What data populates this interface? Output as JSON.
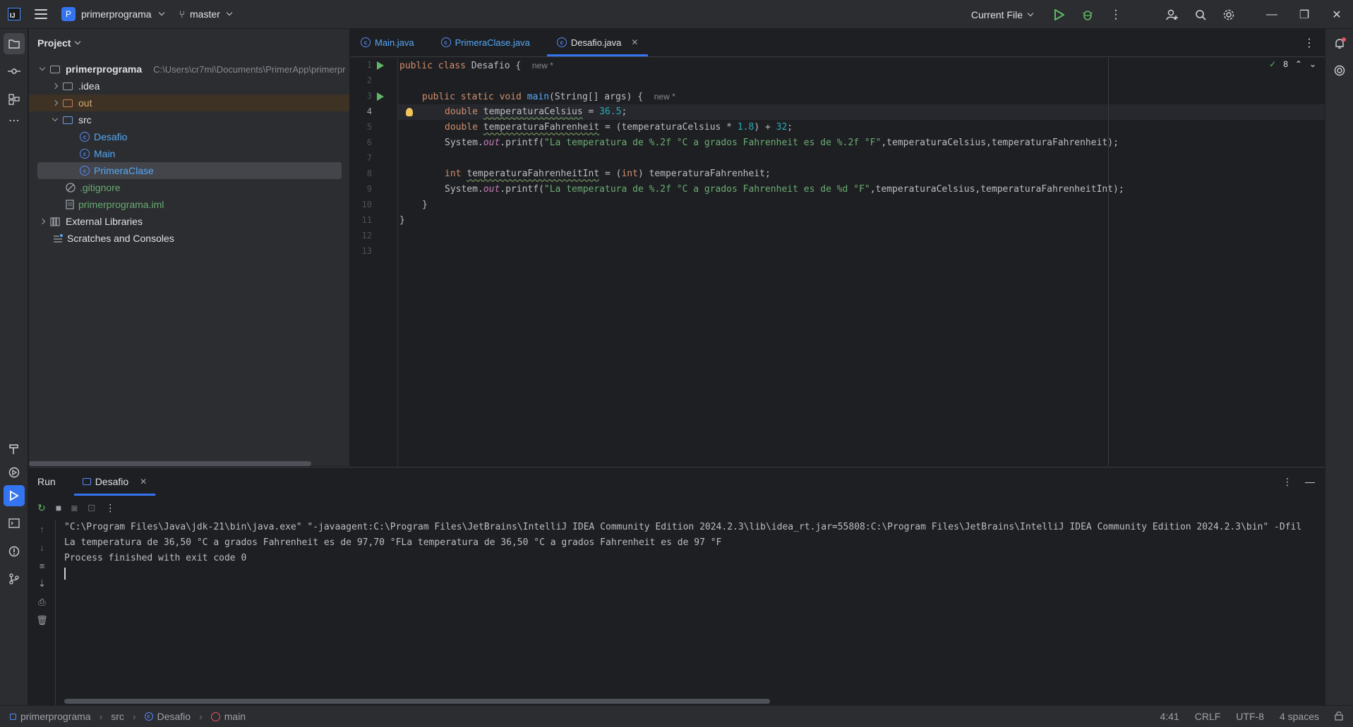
{
  "titlebar": {
    "project_letter": "P",
    "project_name": "primerprograma",
    "branch": "master",
    "run_config": "Current File"
  },
  "project_panel": {
    "title": "Project",
    "root_name": "primerprograma",
    "root_path": "C:\\Users\\cr7mi\\Documents\\PrimerApp\\primerpr",
    "items": [
      {
        "label": ".idea"
      },
      {
        "label": "out"
      },
      {
        "label": "src"
      },
      {
        "label": "Desafio"
      },
      {
        "label": "Main"
      },
      {
        "label": "PrimeraClase"
      },
      {
        "label": ".gitignore"
      },
      {
        "label": "primerprograma.iml"
      },
      {
        "label": "External Libraries"
      },
      {
        "label": "Scratches and Consoles"
      }
    ]
  },
  "editor": {
    "tabs": [
      {
        "label": "Main.java"
      },
      {
        "label": "PrimeraClase.java"
      },
      {
        "label": "Desafio.java"
      }
    ],
    "inspection_count": "8",
    "line_numbers": [
      "1",
      "2",
      "3",
      "4",
      "5",
      "6",
      "7",
      "8",
      "9",
      "10",
      "11",
      "12",
      "13"
    ],
    "hint_new": "new *",
    "code": {
      "l1_kw": "public class",
      "l1_name": "Desafio",
      "l1_brace": " {",
      "l3_kw": "public static void",
      "l3_fn": "main",
      "l3_rest": "(String[] args) {",
      "l4_kw": "double",
      "l4_var": "temperaturaCelsius",
      "l4_eq": " = ",
      "l4_num": "36.5",
      "l4_end": ";",
      "l5_kw": "double",
      "l5_var": "temperaturaFahrenheit",
      "l5_mid": " = (temperaturaCelsius * ",
      "l5_num1": "1.8",
      "l5_mid2": ") + ",
      "l5_num2": "32",
      "l5_end": ";",
      "l6_pre": "System.",
      "l6_out": "out",
      "l6_call": ".printf(",
      "l6_str": "\"La temperatura de %.2f °C a grados Fahrenheit es de %.2f °F\"",
      "l6_end": ",temperaturaCelsius,temperaturaFahrenheit);",
      "l8_kw": "int",
      "l8_var": "temperaturaFahrenheitInt",
      "l8_mid": " = (",
      "l8_kw2": "int",
      "l8_end": ") temperaturaFahrenheit;",
      "l9_pre": "System.",
      "l9_out": "out",
      "l9_call": ".printf(",
      "l9_str": "\"La temperatura de %.2f °C a grados Fahrenheit es de %d °F\"",
      "l9_end": ",temperaturaCelsius,temperaturaFahrenheitInt);",
      "l10": "}",
      "l11": "}"
    }
  },
  "run_panel": {
    "title": "Run",
    "tab_label": "Desafio",
    "console_lines": [
      "\"C:\\Program Files\\Java\\jdk-21\\bin\\java.exe\" \"-javaagent:C:\\Program Files\\JetBrains\\IntelliJ IDEA Community Edition 2024.2.3\\lib\\idea_rt.jar=55808:C:\\Program Files\\JetBrains\\IntelliJ IDEA Community Edition 2024.2.3\\bin\" -Dfil",
      "La temperatura de 36,50 °C a grados Fahrenheit es de 97,70 °FLa temperatura de 36,50 °C a grados Fahrenheit es de 97 °F",
      "Process finished with exit code 0"
    ]
  },
  "statusbar": {
    "crumbs": [
      "primerprograma",
      "src",
      "Desafio",
      "main"
    ],
    "position": "4:41",
    "line_sep": "CRLF",
    "encoding": "UTF-8",
    "indent": "4 spaces"
  },
  "colors": {
    "accent": "#3574f0",
    "keyword": "#cf8e6d",
    "string": "#6aab73",
    "number": "#2aacb8",
    "function": "#56a8f5",
    "run_green": "#5fb865"
  }
}
